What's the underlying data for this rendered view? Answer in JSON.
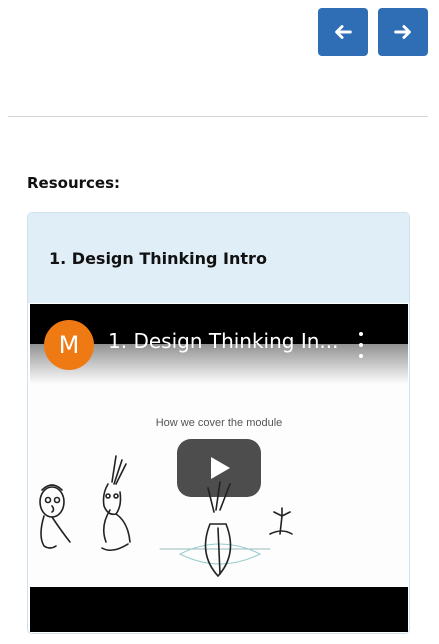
{
  "nav": {
    "prev_icon": "arrow-left-icon",
    "next_icon": "arrow-right-icon",
    "color": "#2f6db4"
  },
  "resources": {
    "label": "Resources:"
  },
  "card": {
    "title": "1. Design Thinking Intro",
    "header_color": "#e0eef7"
  },
  "video": {
    "channel_initial": "M",
    "channel_color": "#ef7a14",
    "title": "1. Design Thinking In...",
    "slide_caption": "How we cover the module",
    "menu_icon": "more-vertical-icon",
    "play_icon": "play-icon"
  }
}
